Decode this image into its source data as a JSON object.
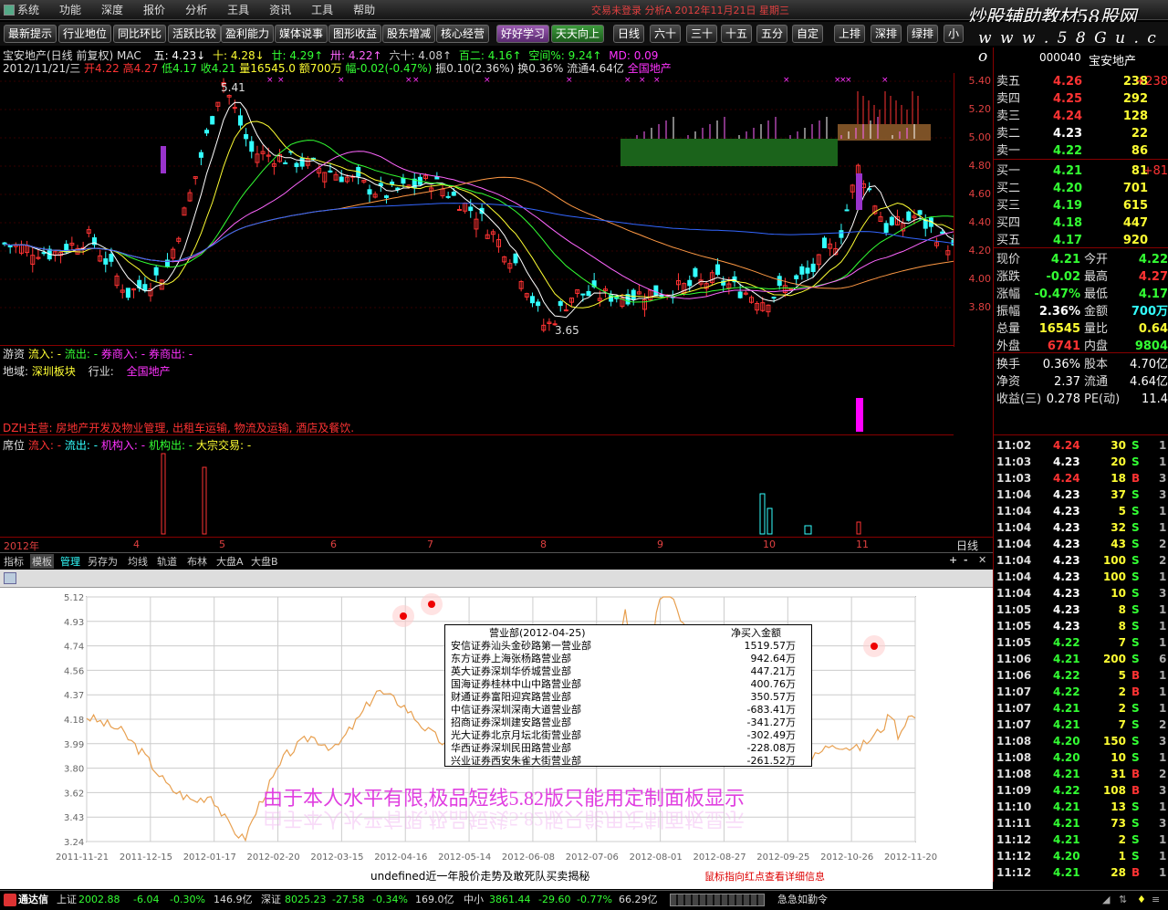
{
  "menus": [
    "系统",
    "功能",
    "深度",
    "报价",
    "分析",
    "王具",
    "资讯",
    "工具",
    "帮助"
  ],
  "title_info": "交易未登录   分析A 2012年11月21日 星期三",
  "watermark": "炒股辅助教材58股网",
  "watermark_url": "w w w . 5 8 G u . c o m",
  "toolbar": [
    "最新提示",
    "行业地位",
    "同比环比",
    "活跃比较",
    "盈利能力",
    "媒体说事",
    "图形收益",
    "股东增减",
    "核心经营",
    "好好学习",
    "天天向上",
    "日线",
    "六十",
    "三十",
    "十五",
    "五分",
    "自定",
    "上排",
    "深排",
    "绿排",
    "小"
  ],
  "info1": {
    "name": "宝安地产(日线 前复权) MAC",
    "ma5": "五: 4.23↓",
    "ma10": "十: 4.28↓",
    "ma20": "廿: 4.29↑",
    "ma30": "卅: 4.22↑",
    "ma60": "六十: 4.08↑",
    "ma100": "百二: 4.16↑",
    "extra": "空间%: 9.24↑",
    "md": "MD: 0.09"
  },
  "info2": {
    "date": "2012/11/21/三",
    "open": "开4.22",
    "high": "高4.27",
    "low": "低4.17",
    "close": "收4.21",
    "vol": "量16545.0",
    "amt": "额700万",
    "chg": "幅-0.02(-0.47%)",
    "amp": "振0.10(2.36%)",
    "turn": "换0.36%",
    "float": "流通4.64亿",
    "sector": "全国地产"
  },
  "price_axis": [
    "5.40",
    "5.20",
    "5.00",
    "4.80",
    "4.60",
    "4.40",
    "4.20",
    "4.00",
    "3.80"
  ],
  "peak_label": "5.41",
  "low_label": "3.65",
  "panel2": {
    "title": "游资",
    "labels": [
      "流入: -",
      "流出: -",
      "券商入: -",
      "券商出: -"
    ],
    "region_label": "地域:",
    "region": "深圳板块",
    "industry_label": "行业:",
    "industry": "全国地产",
    "business": "DZH主营: 房地产开发及物业管理, 出租车运输, 物流及运输, 酒店及餐饮."
  },
  "panel3": {
    "title": "席位",
    "labels": [
      "流入: -",
      "流出: -",
      "机构入: -",
      "机构出: -",
      "大宗交易: -"
    ]
  },
  "date_axis": [
    "2012年",
    "4",
    "5",
    "6",
    "7",
    "8",
    "9",
    "10",
    "11"
  ],
  "period": "日线",
  "tabs": [
    "指标",
    "模板",
    "管理",
    "另存为",
    "均线",
    "轨道",
    "布林",
    "大盘A",
    "大盘B"
  ],
  "quote": {
    "code": "000040",
    "name": "宝安地产",
    "sell": [
      {
        "l": "卖五",
        "p": "4.26",
        "v": "238",
        "c": "+238"
      },
      {
        "l": "卖四",
        "p": "4.25",
        "v": "292",
        "c": ""
      },
      {
        "l": "卖三",
        "p": "4.24",
        "v": "128",
        "c": ""
      },
      {
        "l": "卖二",
        "p": "4.23",
        "v": "22",
        "c": ""
      },
      {
        "l": "卖一",
        "p": "4.22",
        "v": "86",
        "c": ""
      }
    ],
    "buy": [
      {
        "l": "买一",
        "p": "4.21",
        "v": "81",
        "c": "+81"
      },
      {
        "l": "买二",
        "p": "4.20",
        "v": "701",
        "c": ""
      },
      {
        "l": "买三",
        "p": "4.19",
        "v": "615",
        "c": ""
      },
      {
        "l": "买四",
        "p": "4.18",
        "v": "447",
        "c": ""
      },
      {
        "l": "买五",
        "p": "4.17",
        "v": "920",
        "c": ""
      }
    ],
    "stats": [
      [
        "现价",
        "4.21",
        "今开",
        "4.22"
      ],
      [
        "涨跌",
        "-0.02",
        "最高",
        "4.27"
      ],
      [
        "涨幅",
        "-0.47%",
        "最低",
        "4.17"
      ],
      [
        "振幅",
        "2.36%",
        "金额",
        "700万"
      ],
      [
        "总量",
        "16545",
        "量比",
        "0.64"
      ],
      [
        "外盘",
        "6741",
        "内盘",
        "9804"
      ]
    ],
    "stats2": [
      [
        "换手",
        "0.36%",
        "股本",
        "4.70亿"
      ],
      [
        "净资",
        "2.37",
        "流通",
        "4.64亿"
      ],
      [
        "收益(三)",
        "0.278",
        "PE(动)",
        "11.4"
      ]
    ]
  },
  "ticks": [
    [
      "11:02",
      "4.24",
      "30",
      "S",
      "1"
    ],
    [
      "11:03",
      "4.23",
      "20",
      "S",
      "1"
    ],
    [
      "11:03",
      "4.24",
      "18",
      "B",
      "3"
    ],
    [
      "11:04",
      "4.23",
      "37",
      "S",
      "3"
    ],
    [
      "11:04",
      "4.23",
      "5",
      "S",
      "1"
    ],
    [
      "11:04",
      "4.23",
      "32",
      "S",
      "1"
    ],
    [
      "11:04",
      "4.23",
      "43",
      "S",
      "2"
    ],
    [
      "11:04",
      "4.23",
      "100",
      "S",
      "2"
    ],
    [
      "11:04",
      "4.23",
      "100",
      "S",
      "1"
    ],
    [
      "11:04",
      "4.23",
      "10",
      "S",
      "3"
    ],
    [
      "11:05",
      "4.23",
      "8",
      "S",
      "1"
    ],
    [
      "11:05",
      "4.23",
      "8",
      "S",
      "1"
    ],
    [
      "11:05",
      "4.22",
      "7",
      "S",
      "1"
    ],
    [
      "11:06",
      "4.21",
      "200",
      "S",
      "6"
    ],
    [
      "11:06",
      "4.22",
      "5",
      "B",
      "1"
    ],
    [
      "11:07",
      "4.22",
      "2",
      "B",
      "1"
    ],
    [
      "11:07",
      "4.21",
      "2",
      "S",
      "1"
    ],
    [
      "11:07",
      "4.21",
      "7",
      "S",
      "2"
    ],
    [
      "11:08",
      "4.20",
      "150",
      "S",
      "3"
    ],
    [
      "11:08",
      "4.20",
      "10",
      "S",
      "1"
    ],
    [
      "11:08",
      "4.21",
      "31",
      "B",
      "2"
    ],
    [
      "11:09",
      "4.22",
      "108",
      "B",
      "3"
    ],
    [
      "11:10",
      "4.21",
      "13",
      "S",
      "1"
    ],
    [
      "11:11",
      "4.21",
      "73",
      "S",
      "3"
    ],
    [
      "11:12",
      "4.21",
      "2",
      "S",
      "1"
    ],
    [
      "11:12",
      "4.20",
      "1",
      "S",
      "1"
    ],
    [
      "11:12",
      "4.21",
      "28",
      "B",
      "1"
    ]
  ],
  "lower": {
    "y_axis": [
      "5.12",
      "4.93",
      "4.74",
      "4.56",
      "4.37",
      "4.18",
      "3.99",
      "3.80",
      "3.62",
      "3.43",
      "3.24"
    ],
    "x_axis": [
      "2011-11-21",
      "2011-12-15",
      "2012-01-17",
      "2012-02-20",
      "2012-03-15",
      "2012-04-16",
      "2012-05-14",
      "2012-06-08",
      "2012-07-06",
      "2012-08-01",
      "2012-08-27",
      "2012-09-25",
      "2012-10-26",
      "2012-11-20"
    ],
    "table_head": [
      "营业部(2012-04-25)",
      "净买入金额"
    ],
    "table_rows": [
      [
        "安信证券汕头金砂路第一营业部",
        "1519.57万"
      ],
      [
        "东方证券上海张杨路营业部",
        "942.64万"
      ],
      [
        "英大证券深圳华侨城营业部",
        "447.21万"
      ],
      [
        "国海证券桂林中山中路营业部",
        "400.76万"
      ],
      [
        "财通证券富阳迎宾路营业部",
        "350.57万"
      ],
      [
        "中信证券深圳深南大道营业部",
        "-683.41万"
      ],
      [
        "招商证券深圳建安路营业部",
        "-341.27万"
      ],
      [
        "光大证券北京月坛北街营业部",
        "-302.49万"
      ],
      [
        "华西证券深圳民田路营业部",
        "-228.08万"
      ],
      [
        "兴业证券西安朱雀大街营业部",
        "-261.52万"
      ]
    ],
    "big_text": "由于本人水平有限,极品短线5.82版只能用定制面板显示",
    "caption": "undefined近一年股价走势及敢死队买卖揭秘",
    "hint": "鼠标指向红点查看详细信息"
  },
  "status": {
    "sh_label": "上证",
    "sh": "2002.88",
    "sh_chg": "-6.04",
    "sh_pct": "-0.30%",
    "sh_amt": "146.9亿",
    "sz_label": "深证",
    "sz": "8025.23",
    "sz_chg": "-27.58",
    "sz_pct": "-0.34%",
    "sz_amt": "169.0亿",
    "zx_label": "中小",
    "zx": "3861.44",
    "zx_chg": "-29.60",
    "zx_pct": "-0.77%",
    "zx_amt": "66.29亿",
    "ticker": "急急如勤令",
    "brand": "通达信"
  },
  "colors": {
    "up": "#ff3333",
    "down": "#33ff33",
    "yellow": "#ffff33",
    "white": "#ffffff",
    "magenta": "#ff33ff",
    "cyan": "#33ffff"
  }
}
